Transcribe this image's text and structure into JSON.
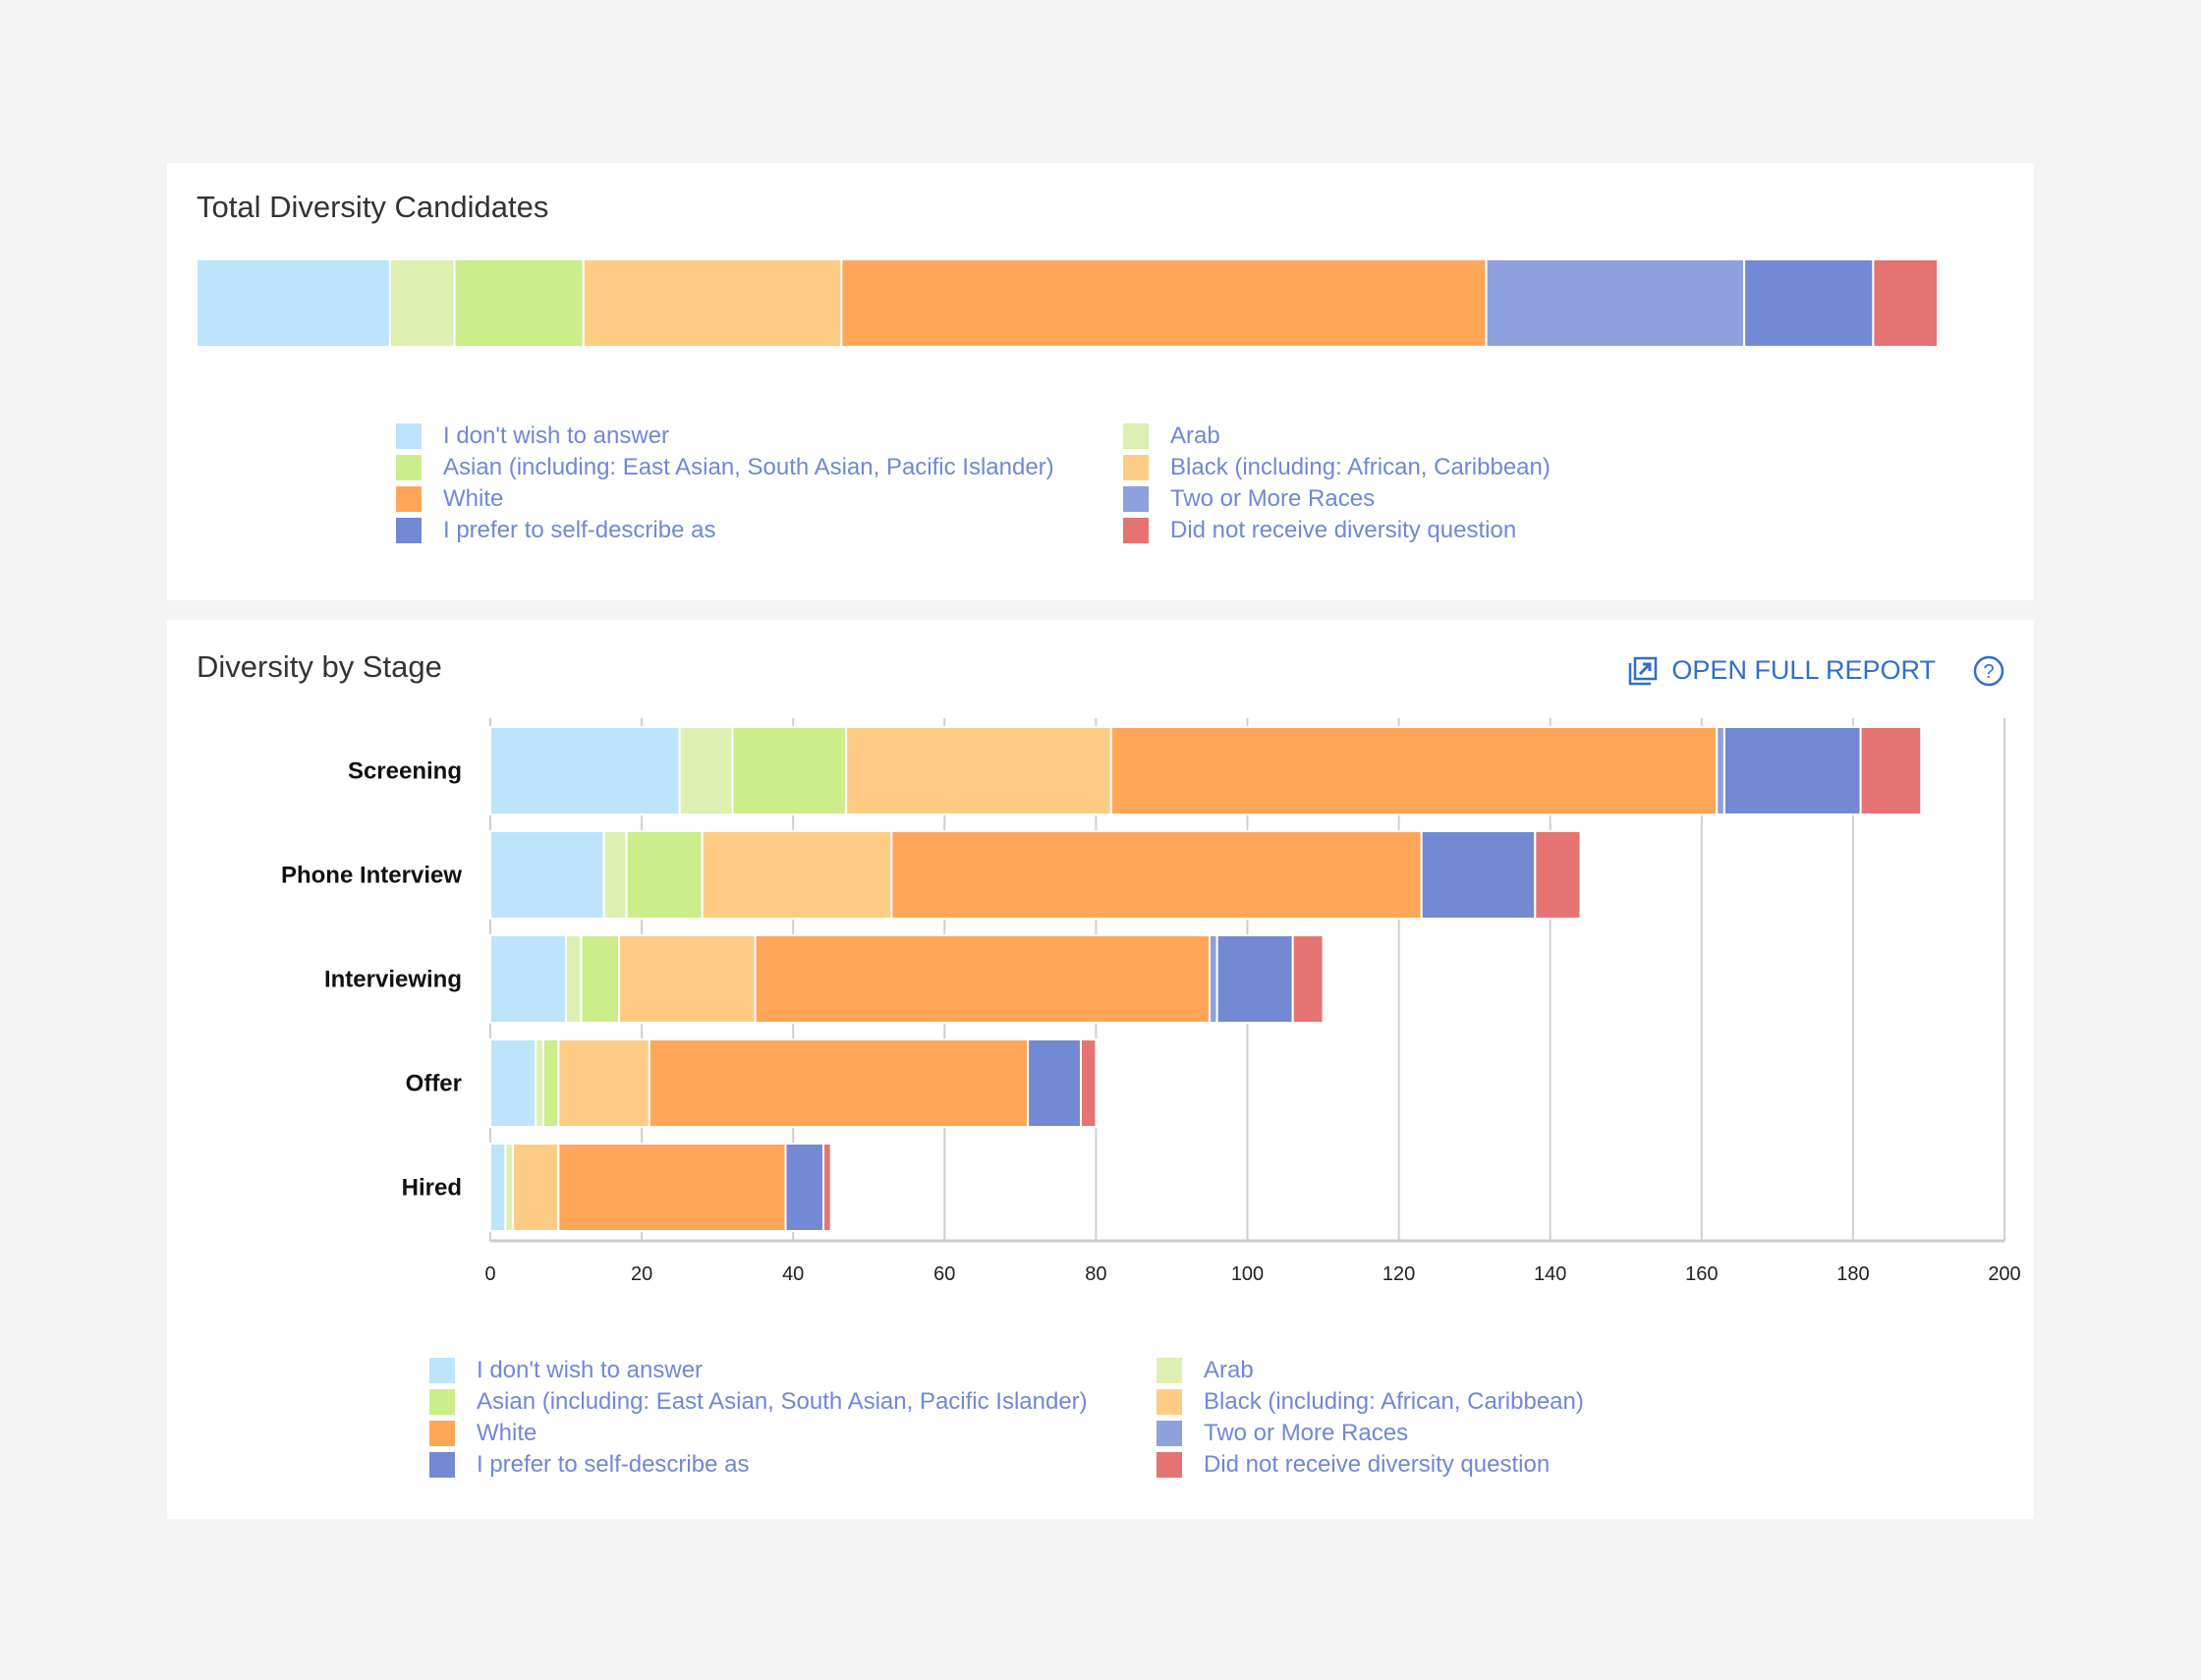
{
  "colors": {
    "dont": "#bde4fb",
    "arab": "#ddf0b1",
    "asian": "#cbed8a",
    "black": "#ffcc85",
    "white": "#ffa658",
    "two": "#8fa1dc",
    "self": "#7389d3",
    "none": "#e57373",
    "link": "#2f6fcb",
    "legend_text": "#7088d4"
  },
  "legend": [
    {
      "key": "dont",
      "label": "I don't wish to answer"
    },
    {
      "key": "arab",
      "label": "Arab"
    },
    {
      "key": "asian",
      "label": "Asian (including: East Asian, South Asian, Pacific Islander)"
    },
    {
      "key": "black",
      "label": "Black (including: African, Caribbean)"
    },
    {
      "key": "white",
      "label": "White"
    },
    {
      "key": "two",
      "label": "Two or More Races"
    },
    {
      "key": "self",
      "label": "I prefer to self-describe as"
    },
    {
      "key": "none",
      "label": "Did not receive diversity question"
    }
  ],
  "header": {
    "open_report": "OPEN FULL REPORT",
    "open_report_icon": "external-link-icon",
    "help_icon": "help-circle-icon"
  },
  "chart_data": [
    {
      "type": "bar",
      "stacked": true,
      "orientation": "horizontal",
      "title": "Total Diversity Candidates",
      "normalized": true,
      "series_keys": [
        "dont",
        "arab",
        "asian",
        "black",
        "white",
        "two",
        "self",
        "none"
      ],
      "values": [
        3,
        1,
        2,
        4,
        10,
        4,
        2,
        1
      ],
      "legend_position": "bottom"
    },
    {
      "type": "bar",
      "stacked": true,
      "orientation": "horizontal",
      "title": "Diversity by Stage",
      "categories": [
        "Screening",
        "Phone Interview",
        "Interviewing",
        "Offer",
        "Hired"
      ],
      "xlim": [
        0,
        200
      ],
      "xticks": [
        "0",
        "20",
        "40",
        "60",
        "80",
        "100",
        "120",
        "140",
        "160",
        "180",
        "200"
      ],
      "grid": true,
      "legend_position": "bottom",
      "series": [
        {
          "key": "dont",
          "values": [
            25,
            15,
            10,
            6,
            2
          ]
        },
        {
          "key": "arab",
          "values": [
            7,
            3,
            2,
            1,
            1
          ]
        },
        {
          "key": "asian",
          "values": [
            15,
            10,
            5,
            2,
            0
          ]
        },
        {
          "key": "black",
          "values": [
            35,
            25,
            18,
            12,
            6
          ]
        },
        {
          "key": "white",
          "values": [
            80,
            70,
            60,
            50,
            30
          ]
        },
        {
          "key": "two",
          "values": [
            1,
            0,
            1,
            0,
            0
          ]
        },
        {
          "key": "self",
          "values": [
            18,
            15,
            10,
            7,
            5
          ]
        },
        {
          "key": "none",
          "values": [
            8,
            6,
            4,
            2,
            1
          ]
        }
      ]
    }
  ]
}
